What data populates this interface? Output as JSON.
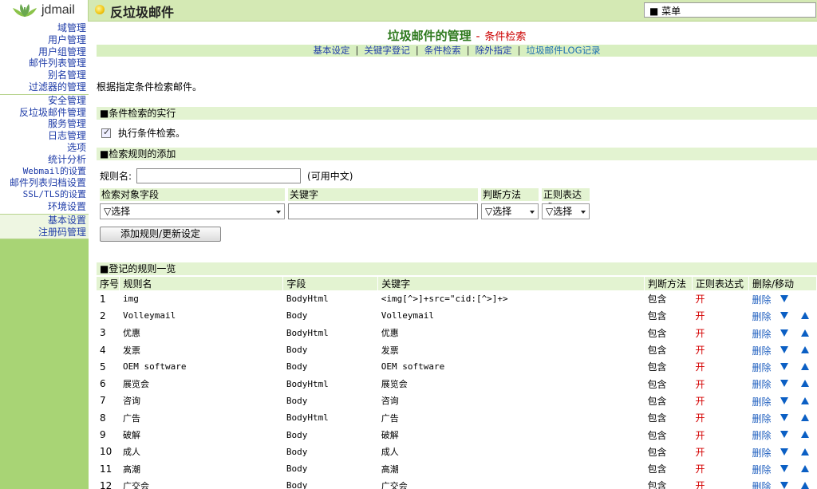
{
  "app": {
    "logo_text": "jdmail",
    "page_title": "反垃圾邮件"
  },
  "menu": {
    "label": "■ 菜单"
  },
  "sidebar": {
    "groups": [
      [
        "域管理",
        "用户管理",
        "用户组管理",
        "邮件列表管理",
        "别名管理",
        "过滤器的管理"
      ],
      [
        "安全管理",
        "反垃圾邮件管理",
        "服务管理",
        "日志管理",
        "选项",
        "统计分析",
        "Webmail的设置",
        "邮件列表归档设置",
        "SSL/TLS的设置",
        "环境设置"
      ],
      [
        "基本设置",
        "注册码管理"
      ]
    ]
  },
  "main": {
    "heading": "垃圾邮件的管理",
    "heading_dash": "-",
    "heading_sub": "条件检索",
    "subnav": [
      "基本设定",
      "关键字登记",
      "条件检索",
      "除外指定",
      "垃圾邮件LOG记录"
    ],
    "subnav_sep": "|",
    "description": "根据指定条件检索邮件。",
    "sec_exec": "■条件检索的实行",
    "exec_label": "执行条件检索。",
    "sec_add": "■检索规则的添加",
    "rule_name_label": "规则名:",
    "rule_name_hint": "(可用中文)",
    "add_headers": [
      "检索对象字段",
      "关键字",
      "判断方法",
      "正则表达式"
    ],
    "field_select": "▽选择",
    "method_select": "▽选择",
    "regex_select": "▽选择",
    "add_button": "添加规则/更新设定",
    "sec_list": "■登记的规则一览"
  },
  "table": {
    "headers": [
      "序号",
      "规则名",
      "字段",
      "关键字",
      "判断方法",
      "正则表达式",
      "删除/移动"
    ],
    "delete_label": "删除",
    "rows": [
      {
        "no": "1",
        "name": "img",
        "field": "BodyHtml",
        "keyword": "<img[^>]+src=\"cid:[^>]+>",
        "method": "包含",
        "regex": "开",
        "up": false,
        "down": true
      },
      {
        "no": "2",
        "name": "Volleymail",
        "field": "Body",
        "keyword": "Volleymail",
        "method": "包含",
        "regex": "开",
        "up": true,
        "down": true
      },
      {
        "no": "3",
        "name": "优惠",
        "field": "BodyHtml",
        "keyword": "优惠",
        "method": "包含",
        "regex": "开",
        "up": true,
        "down": true
      },
      {
        "no": "4",
        "name": "发票",
        "field": "Body",
        "keyword": "发票",
        "method": "包含",
        "regex": "开",
        "up": true,
        "down": true
      },
      {
        "no": "5",
        "name": "OEM software",
        "field": "Body",
        "keyword": "OEM software",
        "method": "包含",
        "regex": "开",
        "up": true,
        "down": true
      },
      {
        "no": "6",
        "name": "展览会",
        "field": "BodyHtml",
        "keyword": "展览会",
        "method": "包含",
        "regex": "开",
        "up": true,
        "down": true
      },
      {
        "no": "7",
        "name": "咨询",
        "field": "Body",
        "keyword": "咨询",
        "method": "包含",
        "regex": "开",
        "up": true,
        "down": true
      },
      {
        "no": "8",
        "name": "广告",
        "field": "BodyHtml",
        "keyword": "广告",
        "method": "包含",
        "regex": "开",
        "up": true,
        "down": true
      },
      {
        "no": "9",
        "name": "破解",
        "field": "Body",
        "keyword": "破解",
        "method": "包含",
        "regex": "开",
        "up": true,
        "down": true
      },
      {
        "no": "10",
        "name": "成人",
        "field": "Body",
        "keyword": "成人",
        "method": "包含",
        "regex": "开",
        "up": true,
        "down": true
      },
      {
        "no": "11",
        "name": "高潮",
        "field": "Body",
        "keyword": "高潮",
        "method": "包含",
        "regex": "开",
        "up": true,
        "down": true
      },
      {
        "no": "12",
        "name": "广交会",
        "field": "Body",
        "keyword": "广交会",
        "method": "包含",
        "regex": "开",
        "up": true,
        "down": true
      }
    ]
  },
  "colors": {
    "brand_green": "#a8d475",
    "section_bg": "#e3f3d1",
    "link": "#1f3ca8",
    "arrow": "#0b5fc4",
    "on": "#d40000"
  }
}
